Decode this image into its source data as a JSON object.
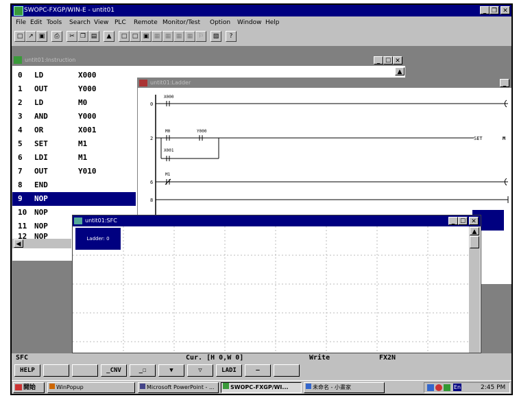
{
  "app": {
    "title": "SWOPC-FXGP/WIN-E - untit01"
  },
  "menu": [
    "File",
    "Edit",
    "Tools",
    "Search",
    "View",
    "PLC",
    "Remote",
    "Monitor/Test",
    "Option",
    "Window",
    "Help"
  ],
  "toolbar": {
    "icons": [
      "new-icon",
      "open-icon",
      "save-icon",
      "print-icon",
      "cut-icon",
      "copy-icon",
      "paste-icon",
      "print-preview-icon",
      "view1-icon",
      "view2-icon",
      "view3-icon",
      "view4-icon",
      "view5-icon",
      "view6-icon",
      "view7-icon",
      "find-icon",
      "window-icon",
      "help-icon"
    ]
  },
  "instruction_window": {
    "title": "untit01:Instruction",
    "rows": [
      {
        "n": "0",
        "op": "LD",
        "arg": "X000"
      },
      {
        "n": "1",
        "op": "OUT",
        "arg": "Y000"
      },
      {
        "n": "2",
        "op": "LD",
        "arg": "M0"
      },
      {
        "n": "3",
        "op": "AND",
        "arg": "Y000"
      },
      {
        "n": "4",
        "op": "OR",
        "arg": "X001"
      },
      {
        "n": "5",
        "op": "SET",
        "arg": "M1"
      },
      {
        "n": "6",
        "op": "LDI",
        "arg": "M1"
      },
      {
        "n": "7",
        "op": "OUT",
        "arg": "Y010"
      },
      {
        "n": "8",
        "op": "END",
        "arg": ""
      },
      {
        "n": "9",
        "op": "NOP",
        "arg": ""
      },
      {
        "n": "10",
        "op": "NOP",
        "arg": ""
      },
      {
        "n": "11",
        "op": "NOP",
        "arg": ""
      },
      {
        "n": "12",
        "op": "NOP",
        "arg": ""
      }
    ],
    "selected_row": "9"
  },
  "ladder_window": {
    "title": "untit01:Ladder",
    "steps": [
      "0",
      "2",
      "6",
      "8"
    ],
    "contacts": [
      "X000",
      "M0",
      "Y000",
      "X001",
      "M1"
    ],
    "coil_label": "SET",
    "coil_arg": "M"
  },
  "sfc_window": {
    "title": "untit01:SFC",
    "ladder_block": "Ladder: 0"
  },
  "statusbar": {
    "mode": "SFC",
    "cursor": "Cur. [H 0,W 0]",
    "access": "Write",
    "plc": "FX2N"
  },
  "fkeys": [
    {
      "label": "HELP"
    },
    {
      "label": ""
    },
    {
      "label": ""
    },
    {
      "label": "_CNV"
    },
    {
      "label": "_☐"
    },
    {
      "label": "▼"
    },
    {
      "label": "▽"
    },
    {
      "label": "LADI"
    },
    {
      "label": "—"
    },
    {
      "label": ""
    }
  ],
  "taskbar": {
    "start": "開始",
    "tasks": [
      {
        "label": "WinPopup"
      },
      {
        "label": "Microsoft PowerPoint - ..."
      },
      {
        "label": "SWOPC-FXGP/WI..."
      },
      {
        "label": "未命名 - 小畫家"
      }
    ],
    "tray_lang": "En",
    "clock": "2:45 PM"
  },
  "colors": {
    "titlebar": "#000080",
    "face": "#c0c0c0",
    "mdi": "#808080",
    "selection": "#000080"
  }
}
